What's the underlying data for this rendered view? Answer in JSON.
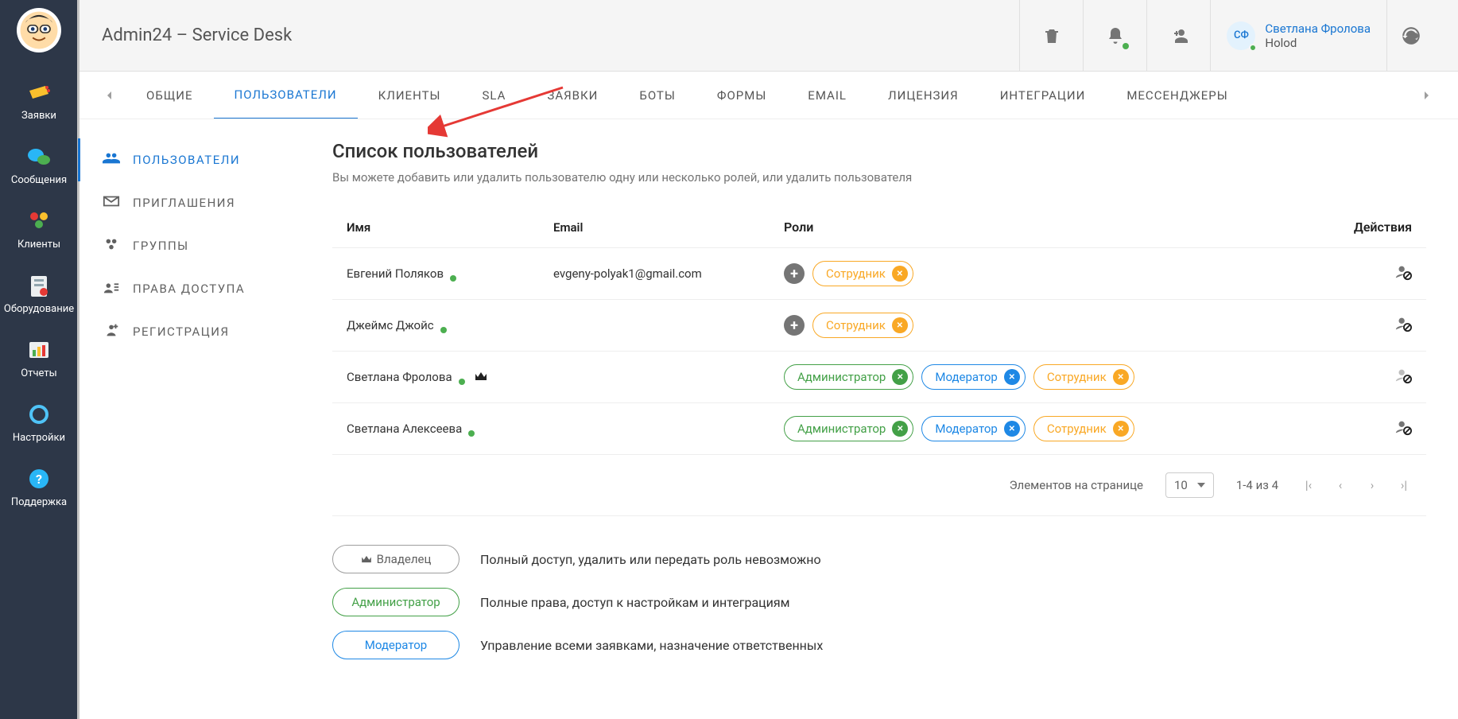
{
  "header": {
    "app_title": "Admin24 – Service Desk",
    "user_initials": "СФ",
    "user_name": "Светлана Фролова",
    "user_company": "Holod"
  },
  "rail": {
    "items": [
      {
        "label": "Заявки"
      },
      {
        "label": "Сообщения"
      },
      {
        "label": "Клиенты"
      },
      {
        "label": "Оборудование"
      },
      {
        "label": "Отчеты"
      },
      {
        "label": "Настройки"
      },
      {
        "label": "Поддержка"
      }
    ]
  },
  "tabs": {
    "items": [
      {
        "label": "ОБЩИЕ"
      },
      {
        "label": "ПОЛЬЗОВАТЕЛИ"
      },
      {
        "label": "КЛИЕНТЫ"
      },
      {
        "label": "SLA"
      },
      {
        "label": "ЗАЯВКИ"
      },
      {
        "label": "БОТЫ"
      },
      {
        "label": "ФОРМЫ"
      },
      {
        "label": "EMAIL"
      },
      {
        "label": "ЛИЦЕНЗИЯ"
      },
      {
        "label": "ИНТЕГРАЦИИ"
      },
      {
        "label": "МЕССЕНДЖЕРЫ"
      }
    ]
  },
  "sub_sidebar": {
    "items": [
      {
        "label": "ПОЛЬЗОВАТЕЛИ"
      },
      {
        "label": "ПРИГЛАШЕНИЯ"
      },
      {
        "label": "ГРУППЫ"
      },
      {
        "label": "ПРАВА ДОСТУПА"
      },
      {
        "label": "РЕГИСТРАЦИЯ"
      }
    ]
  },
  "panel": {
    "title": "Список пользователей",
    "subtitle": "Вы можете добавить или удалить пользователю одну или несколько ролей, или удалить пользователя",
    "columns": {
      "name": "Имя",
      "email": "Email",
      "roles": "Роли",
      "actions": "Действия"
    }
  },
  "users": [
    {
      "name": "Евгений Поляков",
      "email": "evgeny-polyak1@gmail.com",
      "owner": false,
      "add_role": true,
      "roles": [
        {
          "label": "Сотрудник",
          "color": "yellow"
        }
      ],
      "disabled": false
    },
    {
      "name": "Джеймс Джойс",
      "email": "",
      "owner": false,
      "add_role": true,
      "roles": [
        {
          "label": "Сотрудник",
          "color": "yellow"
        }
      ],
      "disabled": false
    },
    {
      "name": "Светлана Фролова",
      "email": "",
      "owner": true,
      "add_role": false,
      "roles": [
        {
          "label": "Администратор",
          "color": "green"
        },
        {
          "label": "Модератор",
          "color": "blue"
        },
        {
          "label": "Сотрудник",
          "color": "yellow"
        }
      ],
      "disabled": true
    },
    {
      "name": "Светлана Алексеева",
      "email": "",
      "owner": false,
      "add_role": false,
      "roles": [
        {
          "label": "Администратор",
          "color": "green"
        },
        {
          "label": "Модератор",
          "color": "blue"
        },
        {
          "label": "Сотрудник",
          "color": "yellow"
        }
      ],
      "disabled": false
    }
  ],
  "pagination": {
    "items_label": "Элементов на странице",
    "page_size": "10",
    "range": "1-4 из 4"
  },
  "legend": [
    {
      "chip": "Владелец",
      "color": "gray",
      "crown": true,
      "desc": "Полный доступ, удалить или передать роль невозможно"
    },
    {
      "chip": "Администратор",
      "color": "green",
      "crown": false,
      "desc": "Полные права, доступ к настройкам и интеграциям"
    },
    {
      "chip": "Модератор",
      "color": "blue",
      "crown": false,
      "desc": "Управление всеми заявками, назначение ответственных"
    }
  ]
}
